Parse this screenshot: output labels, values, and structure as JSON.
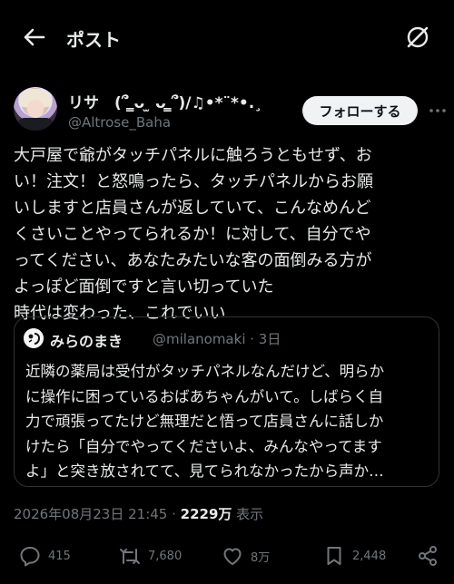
{
  "topbar": {
    "title": "ポスト"
  },
  "author": {
    "display_name": "リサ　(՞ ̳ᴗ ̫ ᴗ ̳՞)/♫•*¨*•.¸",
    "handle": "@Altrose_Baha"
  },
  "follow_label": "フォローする",
  "post": {
    "lines": [
      "大戸屋で爺がタッチパネルに触ろうともせず、お",
      "い！注文！と怒鳴ったら、タッチパネルからお願",
      "いしますと店員さんが返していて、こんなめんど",
      "くさいことやってられるか！に対して、自分でや",
      "ってください、あなたみたいな客の面倒みる方が",
      "よっぽど面倒ですと言い切っていた",
      "時代は変わった、これでいい"
    ]
  },
  "quote": {
    "name": "みらのまき",
    "handle_time": "@milanomaki · 3日",
    "lines": [
      "近隣の薬局は受付がタッチパネルなんだけど、明らか",
      "に操作に困っているおばあちゃんがいて。しばらく自",
      "力で頑張ってたけど無理だと悟って店員さんに話しか",
      "けたら「自分でやってくださいよ、みんなやってます",
      "よ」と突き放されてて、見てられなかったから声か…"
    ]
  },
  "meta": {
    "datetime": "2026年08月23日 21:45 · ",
    "views": "2229万",
    "views_label": " 表示"
  },
  "actions": {
    "replies": "415",
    "reposts": "7,680",
    "likes": "8万",
    "bookmarks": "2,448"
  },
  "colors": {
    "background": "#000000",
    "text": "#e7e9ea",
    "secondary": "#71767b",
    "border": "#2f3336",
    "follow_bg": "#eff3f4"
  },
  "icons": [
    "back-arrow-icon",
    "grok-icon",
    "more-icon",
    "reply-icon",
    "repost-icon",
    "like-icon",
    "bookmark-icon",
    "share-icon"
  ]
}
